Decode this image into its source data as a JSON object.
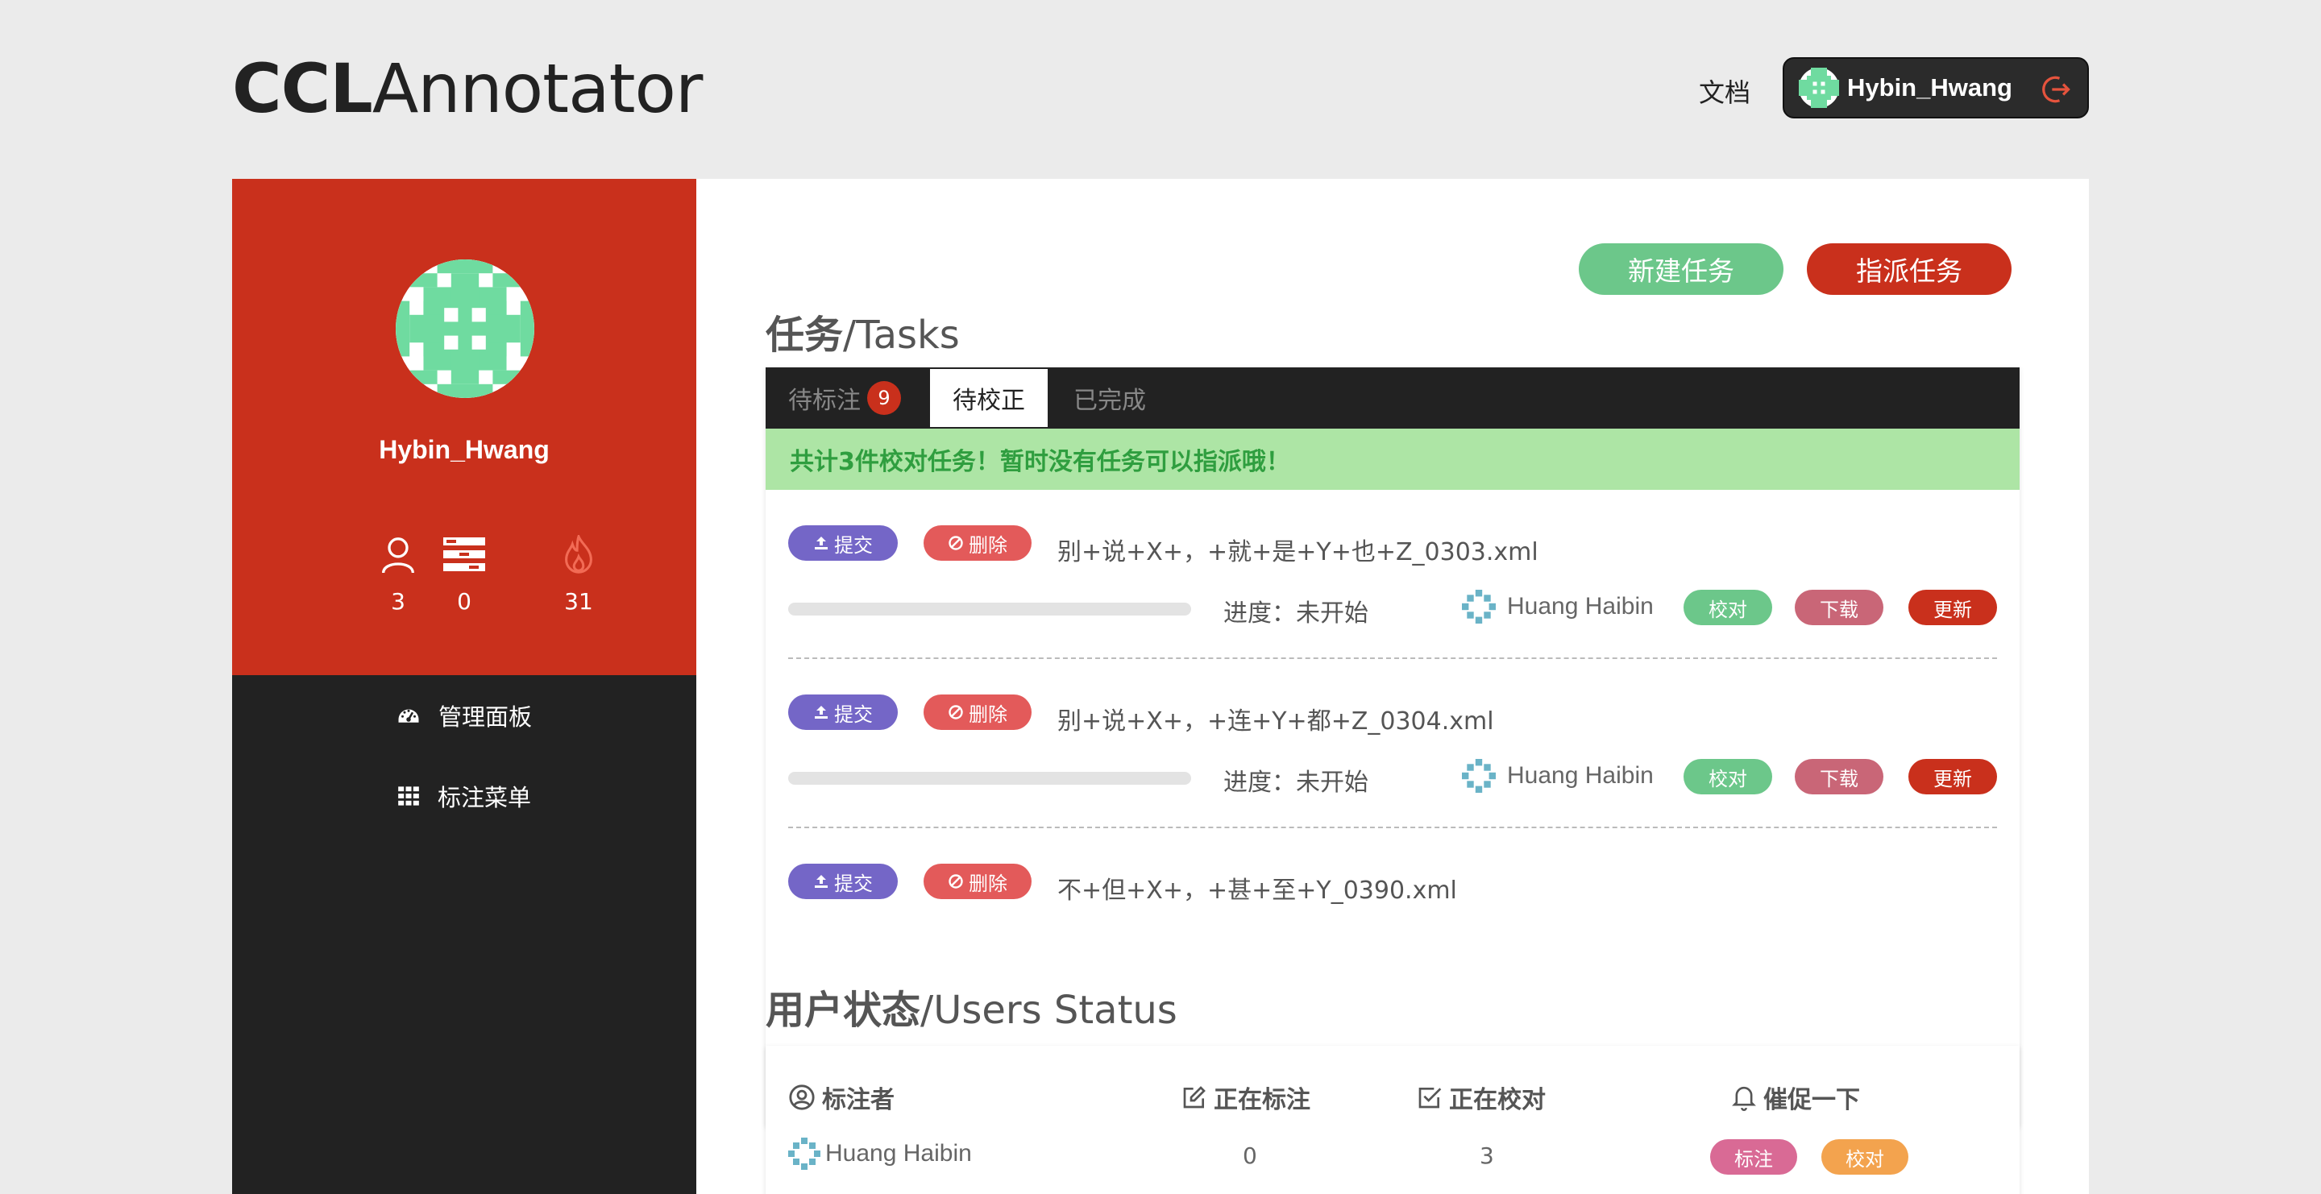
{
  "header": {
    "logo_bold": "CCL",
    "logo_thin": "Annotator",
    "doc_link": "文档",
    "username": "Hybin_Hwang"
  },
  "sidebar": {
    "username": "Hybin_Hwang",
    "stats": [
      {
        "icon": "user-icon",
        "value": "3"
      },
      {
        "icon": "server-icon",
        "value": "0"
      },
      {
        "icon": "fire-icon",
        "value": "31"
      }
    ],
    "menu": [
      {
        "icon": "dashboard-icon",
        "label": "管理面板"
      },
      {
        "icon": "grid-icon",
        "label": "标注菜单"
      }
    ]
  },
  "actions": {
    "new_task": "新建任务",
    "assign_task": "指派任务"
  },
  "tasks": {
    "title_cn": "任务",
    "title_en": "/Tasks",
    "tabs": [
      {
        "label": "待标注",
        "badge": "9"
      },
      {
        "label": "待校正"
      },
      {
        "label": "已完成"
      }
    ],
    "notice": "共计3件校对任务！暂时没有任务可以指派哦！",
    "submit_label": "提交",
    "delete_label": "删除",
    "proofread_label": "校对",
    "download_label": "下载",
    "update_label": "更新",
    "items": [
      {
        "file": "别+说+X+，+就+是+Y+也+Z_0303.xml",
        "progress_text": "进度：未开始",
        "progress": 0,
        "assignee": "Huang Haibin"
      },
      {
        "file": "别+说+X+，+连+Y+都+Z_0304.xml",
        "progress_text": "进度：未开始",
        "progress": 0,
        "assignee": "Huang Haibin"
      },
      {
        "file": "不+但+X+，+甚+至+Y_0390.xml"
      }
    ]
  },
  "users": {
    "title_cn": "用户状态",
    "title_en": "/Users Status",
    "headers": [
      "标注者",
      "正在标注",
      "正在校对",
      "催促一下"
    ],
    "rows": [
      {
        "name": "Huang Haibin",
        "annotating": "0",
        "proofreading": "3",
        "remind_annotate": "标注",
        "remind_proofread": "校对"
      }
    ]
  },
  "colors": {
    "brand_red": "#c9301c",
    "dark": "#222222",
    "green": "#6cc78a",
    "purple": "#7466c7"
  }
}
